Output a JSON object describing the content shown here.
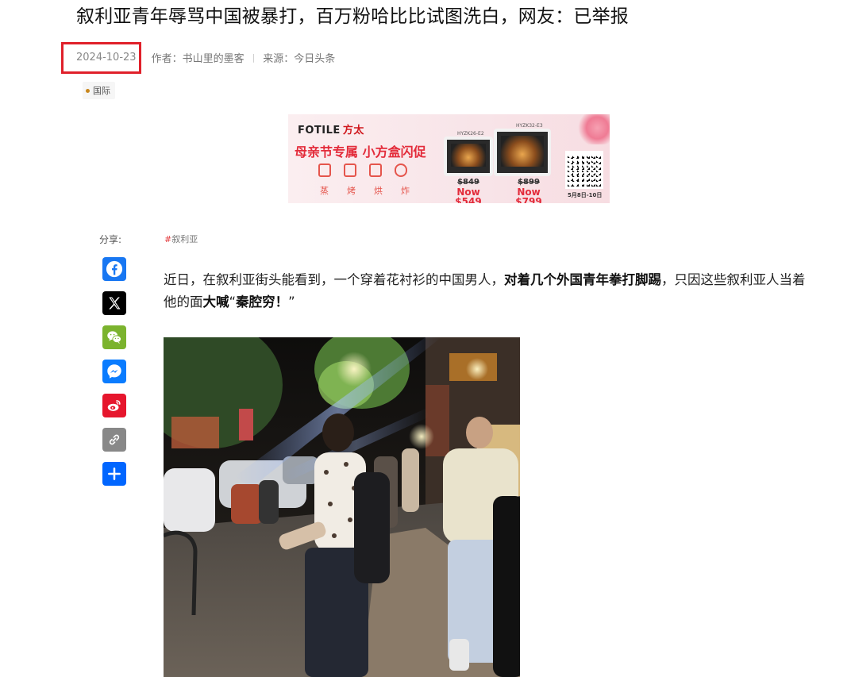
{
  "article": {
    "title": "叙利亚青年辱骂中国被暴打，百万粉哈比比试图洗白，网友：已举报",
    "date": "2024-10-23",
    "author": "作者：书山里的墨客",
    "source": "来源：今日头条",
    "category": "国际",
    "share_label": "分享:",
    "tag": "叙利亚",
    "tag_hash": "#",
    "paragraph": {
      "p1": "近日，在叙利亚街头能看到，一个穿着花衬衫的中国男人，",
      "b1": "对着几个外国青年拳打脚踢",
      "p2": "，只因这些叙利亚人当着他的面",
      "b2": "大喊",
      "p3": "“",
      "b3": "秦腔穷！",
      "p4": "”"
    }
  },
  "ad": {
    "brand_en": "FOTILE",
    "brand_cn": "方太",
    "slogan": "母亲节专属 小方盒闪促",
    "features": [
      "蒸",
      "烤",
      "烘",
      "炸"
    ],
    "products": [
      {
        "model": "HYZK26-E2",
        "old_price": "$849",
        "now_price": "Now $549"
      },
      {
        "model": "HYZK32-E3",
        "old_price": "$899",
        "now_price": "Now $799"
      }
    ],
    "dates": "5月8日-10日"
  },
  "share_buttons": [
    {
      "name": "facebook-icon",
      "color": "#1877f2"
    },
    {
      "name": "x-icon",
      "color": "#000000"
    },
    {
      "name": "wechat-icon",
      "color": "#7bb32e"
    },
    {
      "name": "messenger-icon",
      "color": "#0a7cff"
    },
    {
      "name": "weibo-icon",
      "color": "#e6162d"
    },
    {
      "name": "copy-link-icon",
      "color": "#888888"
    },
    {
      "name": "share-icon",
      "color": "#0166ff"
    }
  ]
}
